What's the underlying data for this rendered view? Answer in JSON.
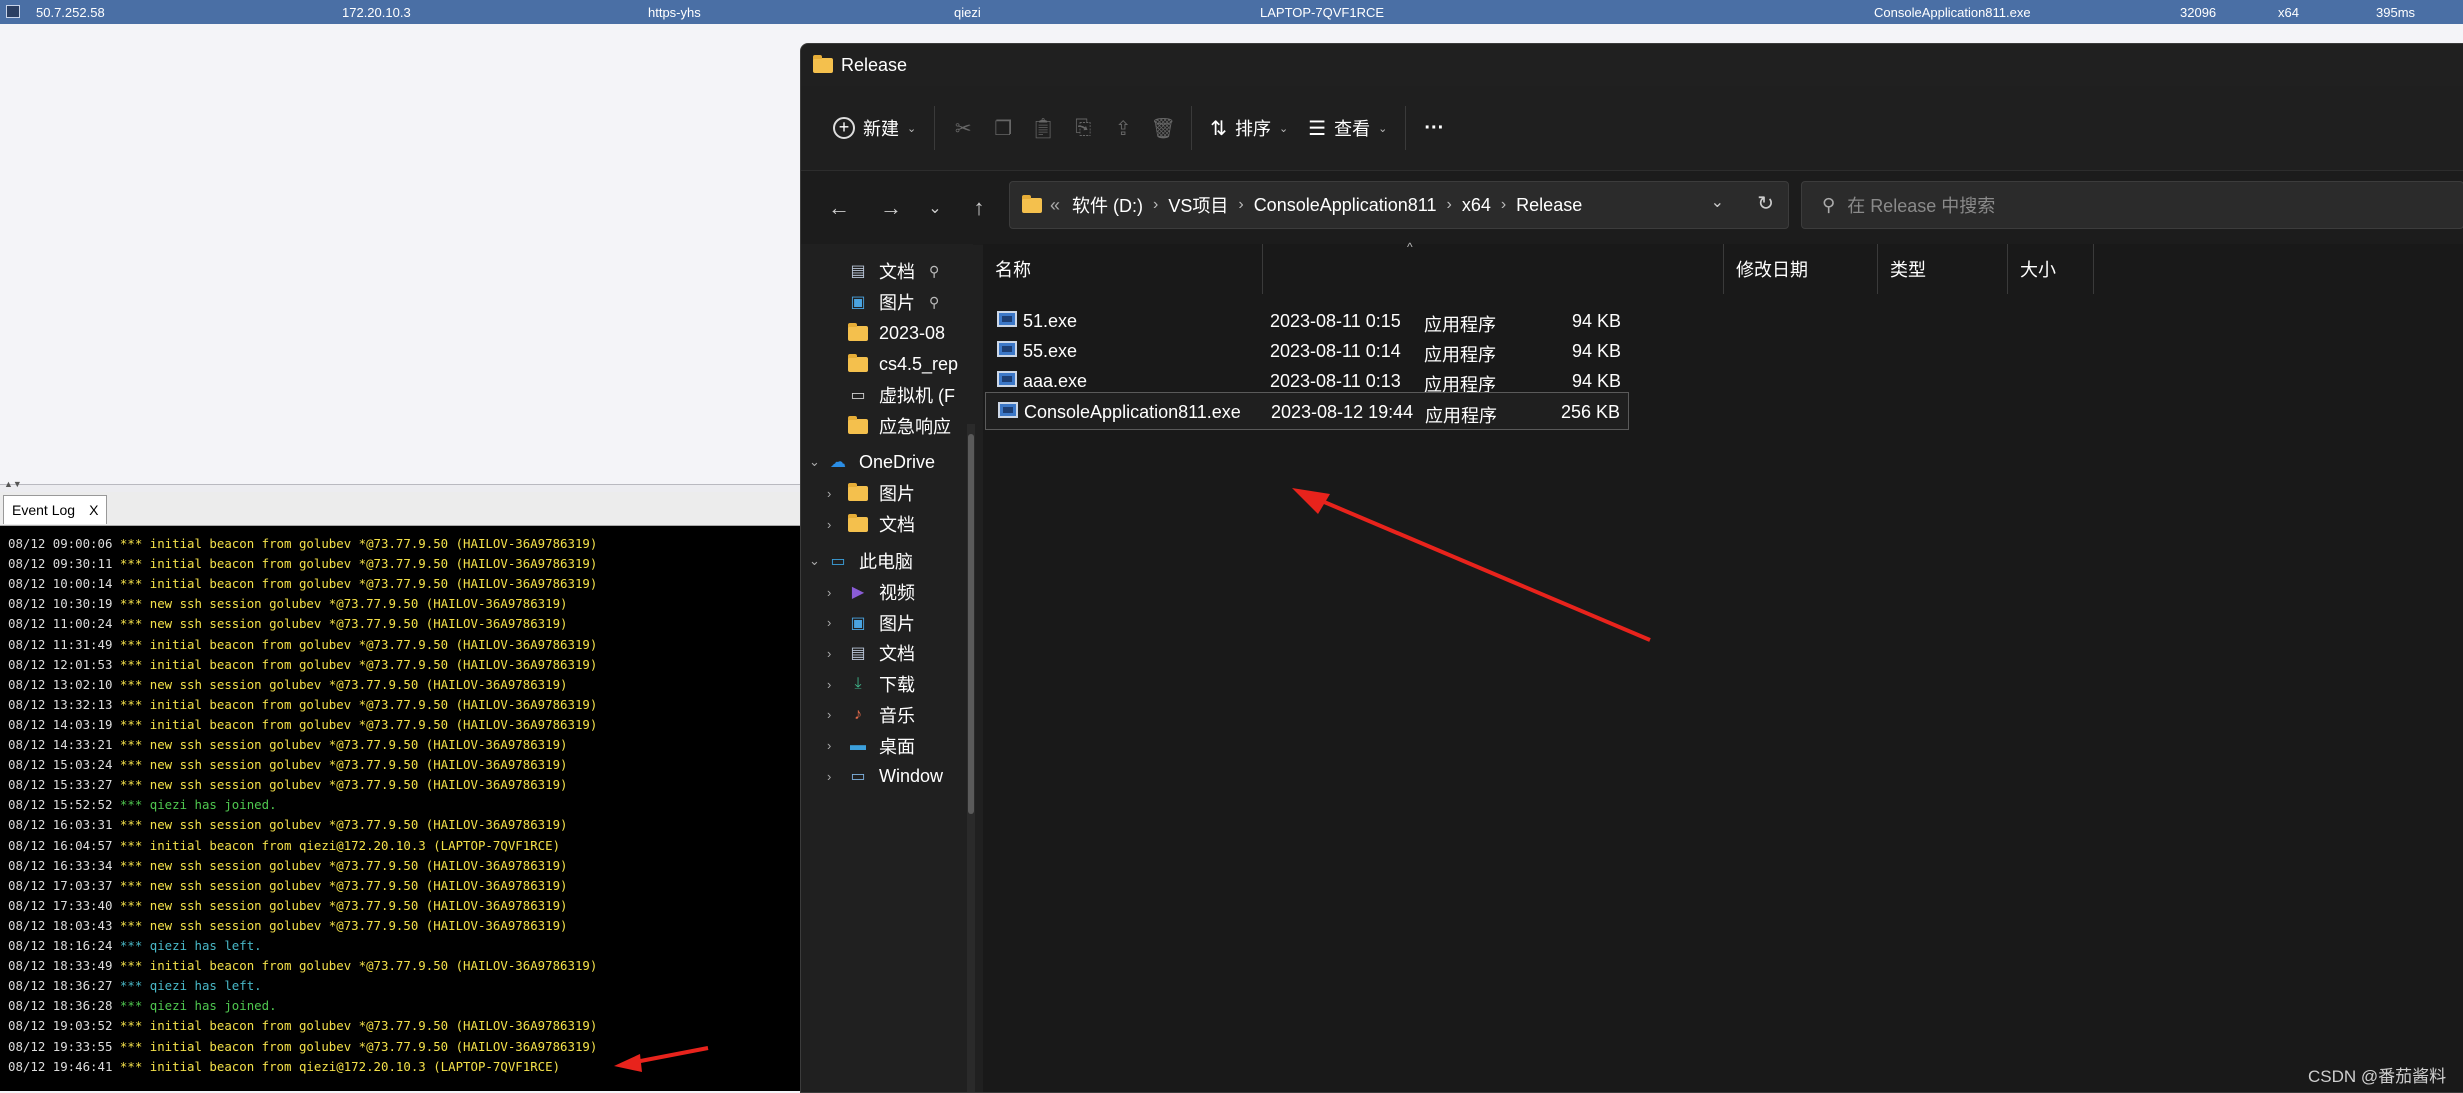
{
  "beacon_row": {
    "external_ip": "50.7.252.58",
    "internal_ip": "172.20.10.3",
    "listener": "https-yhs",
    "user": "qiezi",
    "computer": "LAPTOP-7QVF1RCE",
    "process": "ConsoleApplication811.exe",
    "pid": "32096",
    "arch": "x64",
    "last": "395ms"
  },
  "event_log": {
    "tab_label": "Event Log",
    "tab_close": "X",
    "lines": [
      {
        "ts": "08/12 09:00:06",
        "msg": "*** initial beacon from golubev *@73.77.9.50 (HAILOV-36A9786319)",
        "kind": "beacon"
      },
      {
        "ts": "08/12 09:30:11",
        "msg": "*** initial beacon from golubev *@73.77.9.50 (HAILOV-36A9786319)",
        "kind": "beacon"
      },
      {
        "ts": "08/12 10:00:14",
        "msg": "*** initial beacon from golubev *@73.77.9.50 (HAILOV-36A9786319)",
        "kind": "beacon"
      },
      {
        "ts": "08/12 10:30:19",
        "msg": "*** new ssh session golubev *@73.77.9.50 (HAILOV-36A9786319)",
        "kind": "beacon"
      },
      {
        "ts": "08/12 11:00:24",
        "msg": "*** new ssh session golubev *@73.77.9.50 (HAILOV-36A9786319)",
        "kind": "beacon"
      },
      {
        "ts": "08/12 11:31:49",
        "msg": "*** initial beacon from golubev *@73.77.9.50 (HAILOV-36A9786319)",
        "kind": "beacon"
      },
      {
        "ts": "08/12 12:01:53",
        "msg": "*** initial beacon from golubev *@73.77.9.50 (HAILOV-36A9786319)",
        "kind": "beacon"
      },
      {
        "ts": "08/12 13:02:10",
        "msg": "*** new ssh session golubev *@73.77.9.50 (HAILOV-36A9786319)",
        "kind": "beacon"
      },
      {
        "ts": "08/12 13:32:13",
        "msg": "*** initial beacon from golubev *@73.77.9.50 (HAILOV-36A9786319)",
        "kind": "beacon"
      },
      {
        "ts": "08/12 14:03:19",
        "msg": "*** initial beacon from golubev *@73.77.9.50 (HAILOV-36A9786319)",
        "kind": "beacon"
      },
      {
        "ts": "08/12 14:33:21",
        "msg": "*** new ssh session golubev *@73.77.9.50 (HAILOV-36A9786319)",
        "kind": "beacon"
      },
      {
        "ts": "08/12 15:03:24",
        "msg": "*** new ssh session golubev *@73.77.9.50 (HAILOV-36A9786319)",
        "kind": "beacon"
      },
      {
        "ts": "08/12 15:33:27",
        "msg": "*** new ssh session golubev *@73.77.9.50 (HAILOV-36A9786319)",
        "kind": "beacon"
      },
      {
        "ts": "08/12 15:52:52",
        "msg": "*** qiezi has joined.",
        "kind": "join"
      },
      {
        "ts": "08/12 16:03:31",
        "msg": "*** new ssh session golubev *@73.77.9.50 (HAILOV-36A9786319)",
        "kind": "beacon"
      },
      {
        "ts": "08/12 16:04:57",
        "msg": "*** initial beacon from qiezi@172.20.10.3 (LAPTOP-7QVF1RCE)",
        "kind": "beacon"
      },
      {
        "ts": "08/12 16:33:34",
        "msg": "*** new ssh session golubev *@73.77.9.50 (HAILOV-36A9786319)",
        "kind": "beacon"
      },
      {
        "ts": "08/12 17:03:37",
        "msg": "*** new ssh session golubev *@73.77.9.50 (HAILOV-36A9786319)",
        "kind": "beacon"
      },
      {
        "ts": "08/12 17:33:40",
        "msg": "*** new ssh session golubev *@73.77.9.50 (HAILOV-36A9786319)",
        "kind": "beacon"
      },
      {
        "ts": "08/12 18:03:43",
        "msg": "*** new ssh session golubev *@73.77.9.50 (HAILOV-36A9786319)",
        "kind": "beacon"
      },
      {
        "ts": "08/12 18:16:24",
        "msg": "*** qiezi has left.",
        "kind": "left"
      },
      {
        "ts": "08/12 18:33:49",
        "msg": "*** initial beacon from golubev *@73.77.9.50 (HAILOV-36A9786319)",
        "kind": "beacon"
      },
      {
        "ts": "08/12 18:36:27",
        "msg": "*** qiezi has left.",
        "kind": "left"
      },
      {
        "ts": "08/12 18:36:28",
        "msg": "*** qiezi has joined.",
        "kind": "join"
      },
      {
        "ts": "08/12 19:03:52",
        "msg": "*** initial beacon from golubev *@73.77.9.50 (HAILOV-36A9786319)",
        "kind": "beacon"
      },
      {
        "ts": "08/12 19:33:55",
        "msg": "*** initial beacon from golubev *@73.77.9.50 (HAILOV-36A9786319)",
        "kind": "beacon"
      },
      {
        "ts": "08/12 19:46:41",
        "msg": "*** initial beacon from qiezi@172.20.10.3 (LAPTOP-7QVF1RCE)",
        "kind": "beacon"
      }
    ]
  },
  "explorer": {
    "title": "Release",
    "toolbar": {
      "new_label": "新建",
      "sort_label": "排序",
      "view_label": "查看",
      "more_label": "···"
    },
    "address": {
      "prefix": "«",
      "crumbs": [
        "软件 (D:)",
        "VS项目",
        "ConsoleApplication811",
        "x64",
        "Release"
      ]
    },
    "search_placeholder": "在 Release 中搜索",
    "nav": {
      "quick": [
        {
          "label": "文档",
          "icon": "document-icon",
          "pinned": true
        },
        {
          "label": "图片",
          "icon": "picture-icon",
          "pinned": true
        },
        {
          "label": "2023-08",
          "icon": "folder-icon",
          "pinned": false
        },
        {
          "label": "cs4.5_rep",
          "icon": "folder-icon",
          "pinned": false
        },
        {
          "label": "虚拟机 (F",
          "icon": "drive-icon",
          "pinned": false
        },
        {
          "label": "应急响应",
          "icon": "folder-icon",
          "pinned": false
        }
      ],
      "onedrive": {
        "label": "OneDrive",
        "children": [
          "图片",
          "文档"
        ]
      },
      "thispc": {
        "label": "此电脑",
        "children": [
          {
            "label": "视频",
            "icon": "video-icon"
          },
          {
            "label": "图片",
            "icon": "picture-icon"
          },
          {
            "label": "文档",
            "icon": "document-icon"
          },
          {
            "label": "下载",
            "icon": "download-icon"
          },
          {
            "label": "音乐",
            "icon": "music-icon"
          },
          {
            "label": "桌面",
            "icon": "desktop-icon"
          },
          {
            "label": "Window",
            "icon": "windows-drive-icon"
          }
        ]
      }
    },
    "columns": {
      "name": "名称",
      "modified": "修改日期",
      "type": "类型",
      "size": "大小"
    },
    "files": [
      {
        "name": "51.exe",
        "modified": "2023-08-11 0:15",
        "type": "应用程序",
        "size": "94 KB"
      },
      {
        "name": "55.exe",
        "modified": "2023-08-11 0:14",
        "type": "应用程序",
        "size": "94 KB"
      },
      {
        "name": "aaa.exe",
        "modified": "2023-08-11 0:13",
        "type": "应用程序",
        "size": "94 KB"
      },
      {
        "name": "ConsoleApplication811.exe",
        "modified": "2023-08-12 19:44",
        "type": "应用程序",
        "size": "256 KB"
      }
    ],
    "selected_index": 3
  },
  "watermark": "CSDN @番茄酱料",
  "colors": {
    "log_beacon": "#f3e04a",
    "log_join": "#4fc74f",
    "log_left": "#49b8c8",
    "arrow": "#e8231c",
    "explorer_bg": "#202020"
  }
}
